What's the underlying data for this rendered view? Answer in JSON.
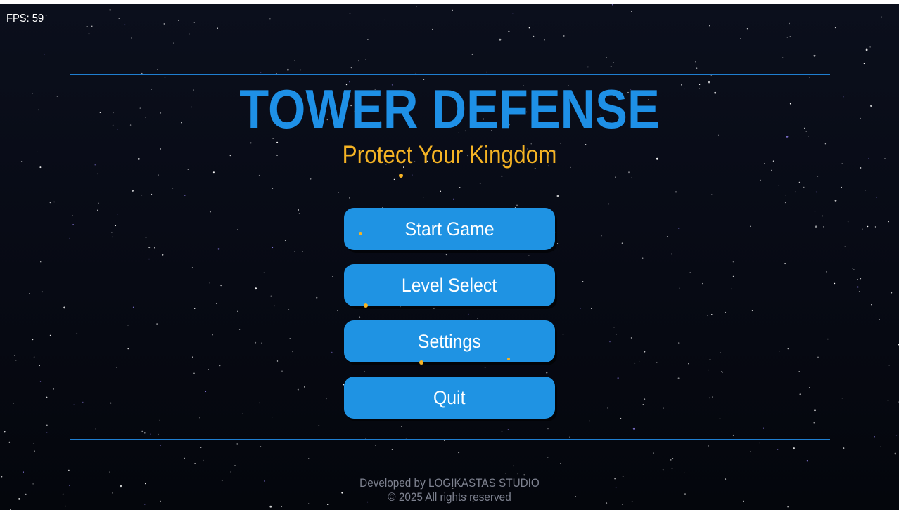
{
  "hud": {
    "fps_label": "FPS: 59"
  },
  "header": {
    "title": "TOWER DEFENSE",
    "subtitle": "Protect Your Kingdom"
  },
  "menu": {
    "items": [
      {
        "label": "Start Game"
      },
      {
        "label": "Level Select"
      },
      {
        "label": "Settings"
      },
      {
        "label": "Quit"
      }
    ]
  },
  "footer": {
    "developer": "Developed by LOGIKASTAS STUDIO",
    "copyright": "© 2025 All rights reserved"
  },
  "colors": {
    "title": "#1e90e6",
    "subtitle": "#f5b324",
    "button": "#1f93e3",
    "divider": "#1f7ed0",
    "spark": "#f5b324"
  }
}
